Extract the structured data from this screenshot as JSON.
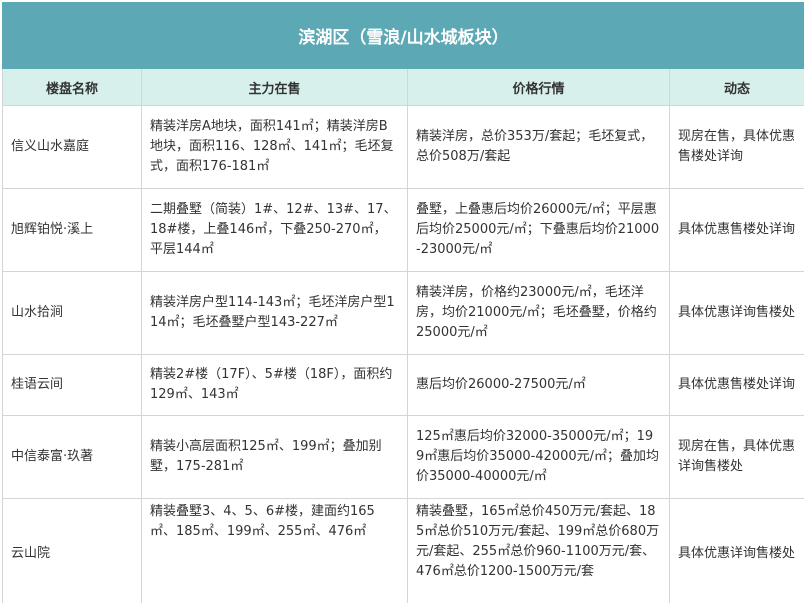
{
  "table": {
    "title": "滨湖区（雪浪/山水城板块）",
    "headers": [
      "楼盘名称",
      "主力在售",
      "价格行情",
      "动态"
    ],
    "rows": [
      {
        "name": "信义山水嘉庭",
        "main": "精装洋房A地块，面积141㎡；精装洋房B地块，面积116、128㎡、141㎡；毛坯复式，面积176-181㎡",
        "price": "精装洋房，总价353万/套起；毛坯复式，总价508万/套起",
        "dynamic": "现房在售，具体优惠售楼处详询"
      },
      {
        "name": "旭辉铂悦·溪上",
        "main": "二期叠墅（简装）1#、12#、13#、17、18#楼，上叠146㎡，下叠250-270㎡，平层144㎡",
        "price": "叠墅，上叠惠后均价26000元/㎡；平层惠后均价25000元/㎡；下叠惠后均价21000-23000元/㎡",
        "dynamic": "具体优惠售楼处详询"
      },
      {
        "name": "山水拾涧",
        "main": "精装洋房户型114-143㎡；毛坯洋房户型114㎡；毛坯叠墅户型143-227㎡",
        "price": "精装洋房，价格约23000元/㎡，毛坯洋房，均价21000元/㎡；毛坯叠墅，价格约25000元/㎡",
        "dynamic": "具体优惠详询售楼处"
      },
      {
        "name": "桂语云间",
        "main": "精装2#楼（17F）、5#楼（18F），面积约129㎡、143㎡",
        "price": "惠后均价26000-27500元/㎡",
        "dynamic": "具体优惠售楼处详询"
      },
      {
        "name": "中信泰富·玖著",
        "main": "精装小高层面积125㎡、199㎡；叠加别墅，175-281㎡",
        "price": "125㎡惠后均价32000-35000元/㎡；199㎡惠后均价35000-42000元/㎡；叠加均价35000-40000元/㎡",
        "dynamic": "现房在售，具体优惠详询售楼处"
      },
      {
        "name": "云山院",
        "main": "精装叠墅3、4、5、6#楼，建面约165㎡、185㎡、199㎡、255㎡、476㎡",
        "price": "精装叠墅，165㎡总价450万元/套起、185㎡总价510万元/套起、199㎡总价680万元/套起、255㎡总价960-1100万元/套、476㎡总价1200-1500万元/套",
        "dynamic": "具体优惠详询售楼处"
      }
    ]
  }
}
